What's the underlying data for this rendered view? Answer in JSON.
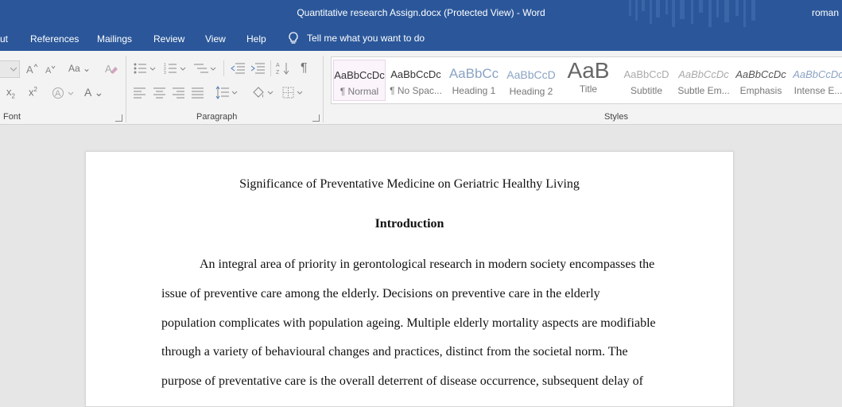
{
  "window": {
    "title": "Quantitative research Assign.docx (Protected View)  -  Word",
    "user": "roman"
  },
  "menu": {
    "items": [
      "ut",
      "References",
      "Mailings",
      "Review",
      "View",
      "Help"
    ],
    "tell_me": "Tell me what you want to do"
  },
  "ribbon": {
    "font_group_label": "Font",
    "paragraph_group_label": "Paragraph",
    "styles_group_label": "Styles",
    "font_buttons": {
      "change_case": "Aa",
      "subscript": "x",
      "superscript": "x",
      "font_color": "A"
    },
    "styles": [
      {
        "preview": "AaBbCcDc",
        "name": "¶ Normal"
      },
      {
        "preview": "AaBbCcDc",
        "name": "¶ No Spac..."
      },
      {
        "preview": "AaBbCc",
        "name": "Heading 1"
      },
      {
        "preview": "AaBbCcD",
        "name": "Heading 2"
      },
      {
        "preview": "AaB",
        "name": "Title"
      },
      {
        "preview": "AaBbCcD",
        "name": "Subtitle"
      },
      {
        "preview": "AaBbCcDc",
        "name": "Subtle Em..."
      },
      {
        "preview": "AaBbCcDc",
        "name": "Emphasis"
      },
      {
        "preview": "AaBbCcDc",
        "name": "Intense E..."
      }
    ]
  },
  "document": {
    "title": "Significance of Preventative Medicine on Geriatric Healthy Living",
    "heading": "Introduction",
    "lines": [
      "An integral area of priority in gerontological research in modern society encompasses the",
      "issue of preventive care among the elderly. Decisions on preventive care in the elderly",
      "population complicates with population ageing. Multiple elderly mortality aspects are modifiable",
      "through a variety of behavioural changes and practices, distinct from the societal norm. The",
      "purpose of preventative care is the overall deterrent of disease occurrence, subsequent delay of"
    ]
  },
  "colors": {
    "titlebar": "#2b579a",
    "ribbon": "#f3f3f3",
    "canvas": "#e6e6e6"
  }
}
